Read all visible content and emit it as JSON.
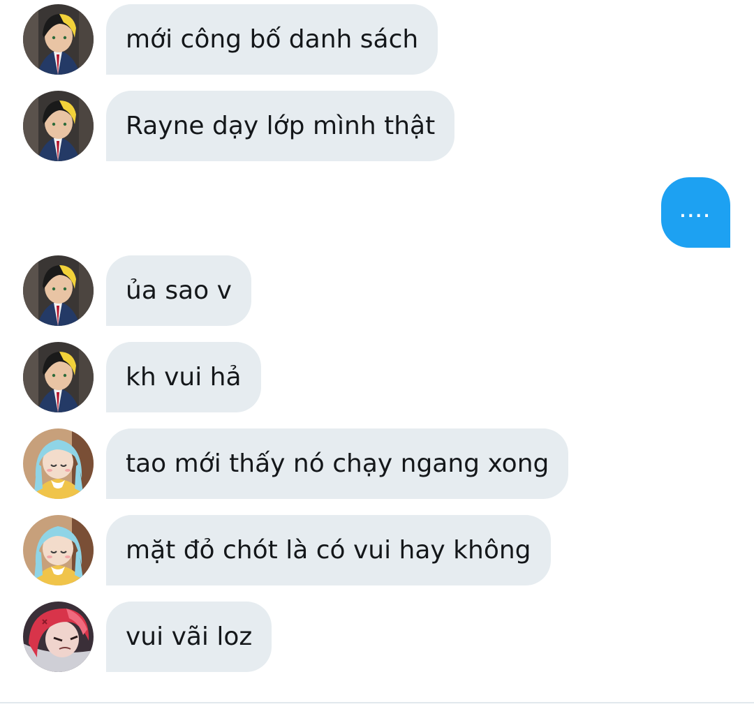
{
  "conversation": {
    "messages": [
      {
        "text": "mới công bố danh sách"
      },
      {
        "text": "Rayne dạy lớp mình thật"
      },
      {
        "text": "...."
      },
      {
        "text": "ủa sao v"
      },
      {
        "text": "kh vui hả"
      },
      {
        "text": "tao mới thấy nó chạy ngang xong"
      },
      {
        "text": "mặt đỏ chót là có vui hay không"
      },
      {
        "text": "vui vãi loz"
      }
    ]
  },
  "colors": {
    "incoming_bubble": "#e6ecf0",
    "outgoing_bubble": "#1da1f2",
    "text": "#14171a"
  },
  "icons": {
    "avatar_a": "blonde-black-haired-anime-avatar-icon",
    "avatar_b": "light-blue-haired-anime-avatar-icon",
    "avatar_c": "red-haired-anime-avatar-icon"
  }
}
